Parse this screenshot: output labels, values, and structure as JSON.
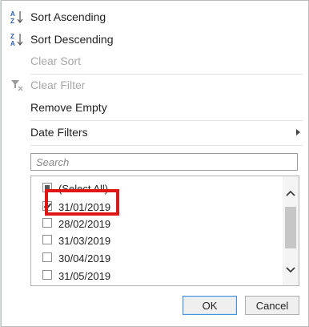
{
  "menu": {
    "sort_ascending": "Sort Ascending",
    "sort_descending": "Sort Descending",
    "clear_sort": "Clear Sort",
    "clear_filter": "Clear Filter",
    "remove_empty": "Remove Empty",
    "date_filters": "Date Filters"
  },
  "search": {
    "placeholder": "Search"
  },
  "list": {
    "items": [
      {
        "label": "(Select All)",
        "state": "partial"
      },
      {
        "label": "31/01/2019",
        "state": "checked"
      },
      {
        "label": "28/02/2019",
        "state": "unchecked"
      },
      {
        "label": "31/03/2019",
        "state": "unchecked"
      },
      {
        "label": "30/04/2019",
        "state": "unchecked"
      },
      {
        "label": "31/05/2019",
        "state": "unchecked"
      }
    ]
  },
  "buttons": {
    "ok": "OK",
    "cancel": "Cancel"
  },
  "colors": {
    "highlight": "#e01616",
    "ok_border": "#4a90d9",
    "icon_blue": "#2a5db0"
  },
  "icons": {
    "sort_asc": "sort-az-icon",
    "sort_desc": "sort-za-icon",
    "clear_filter": "clear-filter-icon",
    "submenu": "chevron-right-icon",
    "scroll_up": "chevron-up-icon",
    "scroll_down": "chevron-down-icon"
  }
}
